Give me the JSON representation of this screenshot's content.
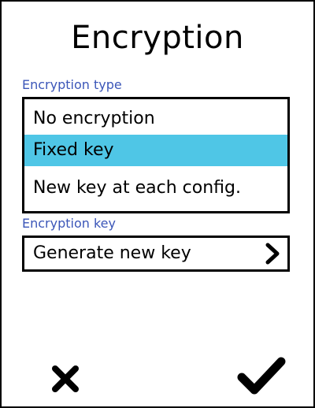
{
  "screen": {
    "title": "Encryption"
  },
  "encryption_type": {
    "label": "Encryption type",
    "options": [
      "No encryption",
      "Fixed key",
      "New key at each config."
    ],
    "selected": "Fixed key"
  },
  "encryption_key": {
    "label": "Encryption key",
    "action_label": "Generate new key",
    "action_icon": "chevron-right-icon"
  },
  "footer": {
    "cancel_icon": "close-icon",
    "confirm_icon": "checkmark-icon"
  },
  "colors": {
    "section_label": "#3b56b8",
    "selection_highlight": "#4fc6e6",
    "border": "#000000"
  }
}
